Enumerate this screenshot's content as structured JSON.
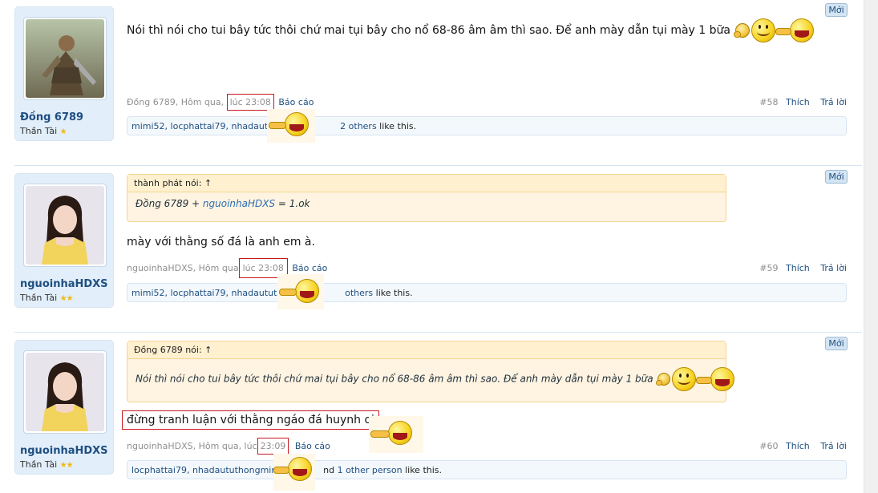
{
  "posts": [
    {
      "badge": "Mới",
      "username": "Đồng 6789",
      "usertitle": "Thần Tài",
      "stars": "★",
      "text": "Nói thì nói cho tui bây tức thôi chứ mai tụi bây cho nổ 68-86 âm âm thì sao. Để anh mày dẫn tụi mày 1 bữa",
      "meta_author": "Đồng 6789,",
      "meta_day": "Hôm qua,",
      "meta_time": "lúc 23:08",
      "report": "Báo cáo",
      "post_number": "#58",
      "like": "Thích",
      "reply": "Trả lời",
      "likes_names": "mimi52, locphattai79, nhadaututho",
      "likes_tail_link": "2 others",
      "likes_suffix": " like this."
    },
    {
      "badge": "Mới",
      "username": "nguoinhaHDXS",
      "usertitle": "Thần Tài",
      "stars": "★★",
      "quote_author": "thành phát nói: ↑",
      "quote_text_a": "Đồng 6789 + ",
      "quote_text_link": "nguoinhaHDXS",
      "quote_text_b": " = 1.ok",
      "text": "mày với thằng số đá là anh em à.",
      "meta_author": "nguoinhaHDXS,",
      "meta_day": "Hôm qua",
      "meta_time": "lúc 23:08",
      "report": "Báo cáo",
      "post_number": "#59",
      "like": "Thích",
      "reply": "Trả lời",
      "likes_names": "mimi52, locphattai79, nhadaututhong",
      "likes_tail_link": "others",
      "likes_suffix": " like this."
    },
    {
      "badge": "Mới",
      "username": "nguoinhaHDXS",
      "usertitle": "Thần Tài",
      "stars": "★★",
      "quote_author": "Đồng 6789 nói: ↑",
      "quote_text": "Nói thì nói cho tui bây tức thôi chứ mai tụi bây cho nổ 68-86 âm âm thì sao. Để anh mày dẫn tụi mày 1 bữa",
      "text": "đừng tranh luận với thằng ngáo đá huynh ơi",
      "meta_author": "nguoinhaHDXS,",
      "meta_day": "Hôm qua, lúc",
      "meta_time": "23:09",
      "report": "Báo cáo",
      "post_number": "#60",
      "like": "Thích",
      "reply": "Trả lời",
      "likes_names": "locphattai79, nhadaututhongminh, tr",
      "likes_mid": "nd ",
      "likes_tail_link": "1 other person",
      "likes_suffix": " like this."
    }
  ],
  "colors": {
    "highlight_box": "#c8181e",
    "link": "#1e4f81",
    "panel_bg": "#e2eef9",
    "quote_bg": "#fff4e1"
  }
}
